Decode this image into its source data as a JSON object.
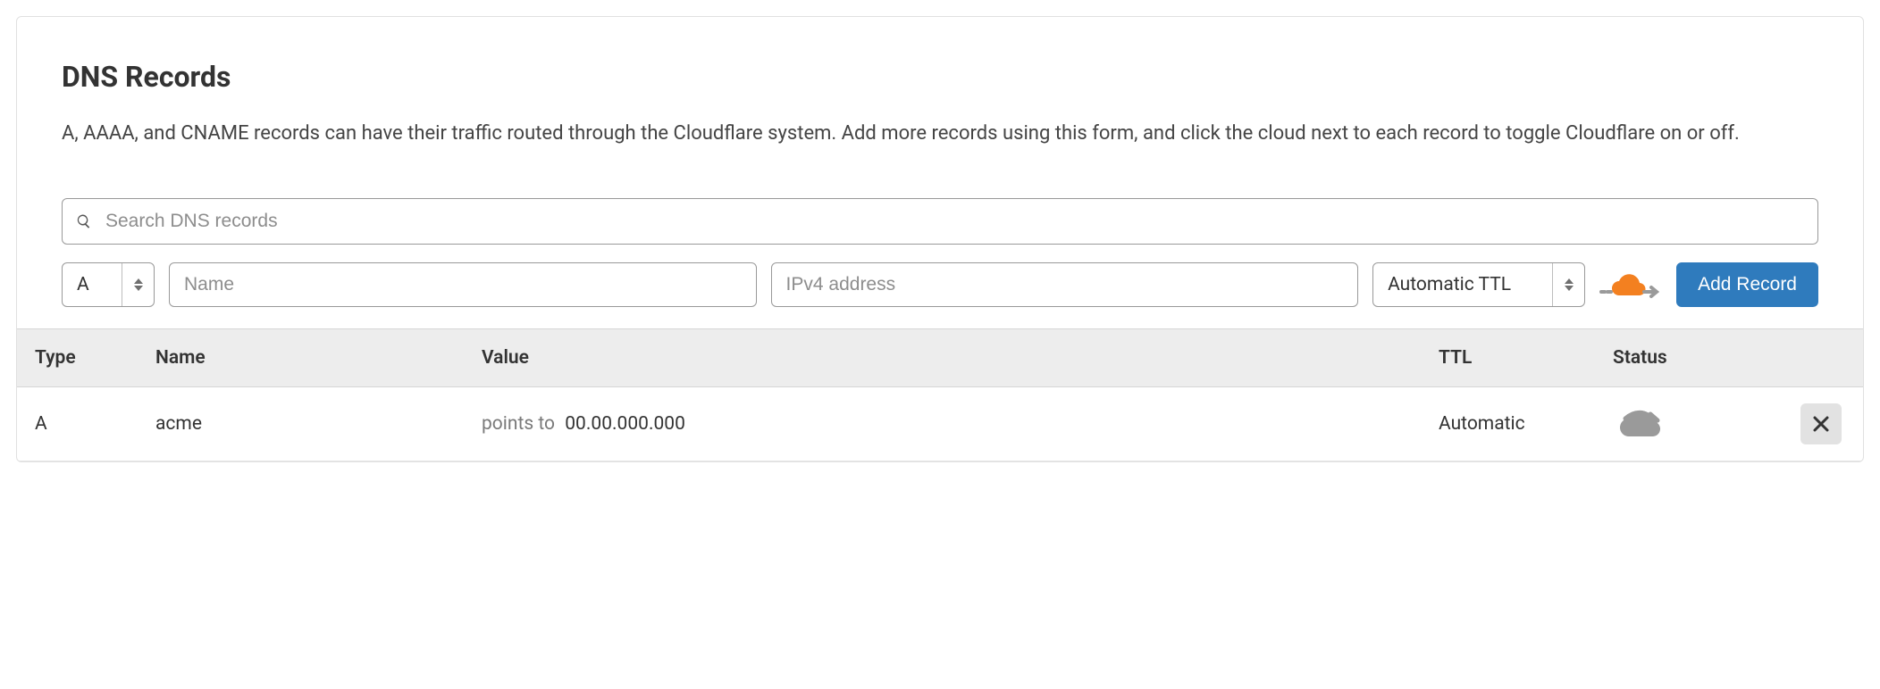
{
  "header": {
    "title": "DNS Records",
    "description": "A, AAAA, and CNAME records can have their traffic routed through the Cloudflare system. Add more records using this form, and click the cloud next to each record to toggle Cloudflare on or off."
  },
  "search": {
    "placeholder": "Search DNS records",
    "value": ""
  },
  "form": {
    "type": "A",
    "name_placeholder": "Name",
    "name_value": "",
    "value_placeholder": "IPv4 address",
    "value_value": "",
    "ttl": "Automatic TTL",
    "proxy_status": "proxied",
    "add_label": "Add Record"
  },
  "table": {
    "columns": {
      "type": "Type",
      "name": "Name",
      "value": "Value",
      "ttl": "TTL",
      "status": "Status"
    },
    "value_prefix": "points to",
    "rows": [
      {
        "type": "A",
        "name": "acme",
        "value": "00.00.000.000",
        "ttl": "Automatic",
        "proxy_status": "dns-only"
      }
    ]
  },
  "colors": {
    "accent": "#2f7bbd",
    "proxied": "#f38020",
    "dns_only": "#9a9a9a"
  }
}
